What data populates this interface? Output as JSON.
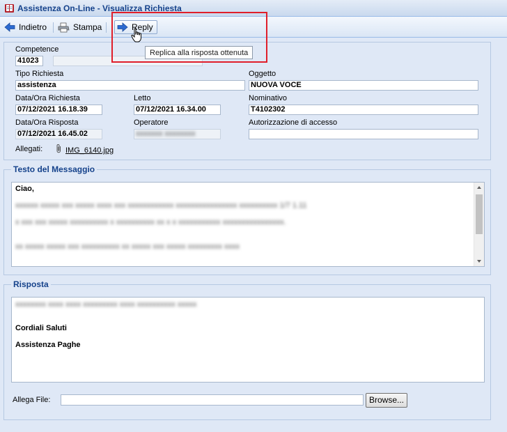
{
  "window": {
    "title": "Assistenza On-Line - Visualizza Richiesta"
  },
  "toolbar": {
    "back_label": "Indietro",
    "print_label": "Stampa",
    "reply_label": "Reply",
    "reply_tooltip": "Replica alla risposta ottenuta"
  },
  "details": {
    "competence_label": "Competence",
    "competence_value": "41023",
    "competence_extra": "",
    "request_type_label": "Tipo Richiesta",
    "request_type_value": "assistenza",
    "subject_label": "Oggetto",
    "subject_value": "NUOVA VOCE",
    "request_datetime_label": "Data/Ora Richiesta",
    "request_datetime_value": "07/12/2021 16.18.39",
    "read_label": "Letto",
    "read_value": "07/12/2021 16.34.00",
    "name_label": "Nominativo",
    "name_value": "T4102302",
    "response_datetime_label": "Data/Ora Risposta",
    "response_datetime_value": "07/12/2021 16.45.02",
    "operator_label": "Operatore",
    "operator_value": "xxxxxxx xxxxxxxx",
    "access_auth_label": "Autorizzazione di accesso",
    "access_auth_value": "",
    "attachments_label": "Allegati:",
    "attachment_file": "IMG_6140.jpg"
  },
  "message": {
    "legend": "Testo del Messaggio",
    "greeting": "Ciao,",
    "line1": "xxxxxx xxxxx xxx xxxxx xxxx xxx xxxxxxxxxxxx xxxxxxxxxxxxxxxx xxxxxxxxxx 1/7 1.11",
    "line2": "x xxx xxx xxxxx xxxxxxxxxx x xxxxxxxxxx xx x x xxxxxxxxxxx xxxxxxxxxxxxxxxx.",
    "line3": "xx xxxxx xxxxx xxx xxxxxxxxxx xx xxxxx xxx xxxxx xxxxxxxxx xxxx"
  },
  "response": {
    "legend": "Risposta",
    "line1": "xxxxxxxx xxxx xxxx xxxxxxxxx xxxx xxxxxxxxxx xxxxx",
    "closing": "Cordiali Saluti",
    "signature": "Assistenza Paghe"
  },
  "attach": {
    "label": "Allega File:",
    "file_value": "",
    "browse_label": "Browse..."
  },
  "colors": {
    "background": "#dfe8f6",
    "title_text": "#15428b",
    "highlight": "#e01e2a"
  }
}
